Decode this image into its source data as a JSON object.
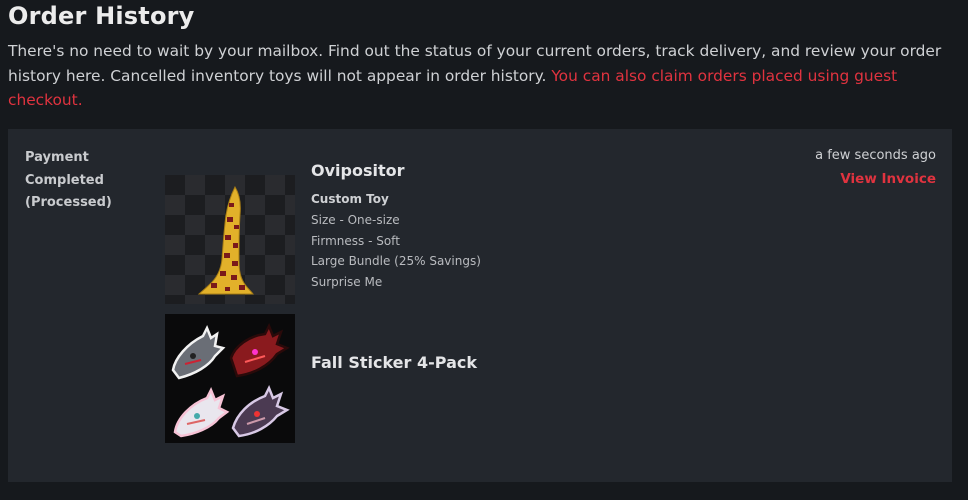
{
  "header": {
    "title": "Order History",
    "intro_text": "There's no need to wait by your mailbox. Find out the status of your current orders, track delivery, and review your order history here. Cancelled inventory toys will not appear in order history. ",
    "guest_link": "You can also claim orders placed using guest checkout."
  },
  "order": {
    "status_line1": "Payment",
    "status_line2": "Completed",
    "status_line3": "(Processed)",
    "time_ago": "a few seconds ago",
    "invoice_label": "View Invoice",
    "items": [
      {
        "name": "Ovipositor",
        "type": "Custom Toy",
        "options": [
          "Size - One-size",
          "Firmness - Soft",
          "Large Bundle (25% Savings)",
          "Surprise Me"
        ]
      },
      {
        "name": "Fall Sticker 4-Pack"
      }
    ]
  },
  "colors": {
    "background": "#16191d",
    "card": "#23272d",
    "accent_red": "#e0333f",
    "toy_gold": "#e2b12a"
  }
}
